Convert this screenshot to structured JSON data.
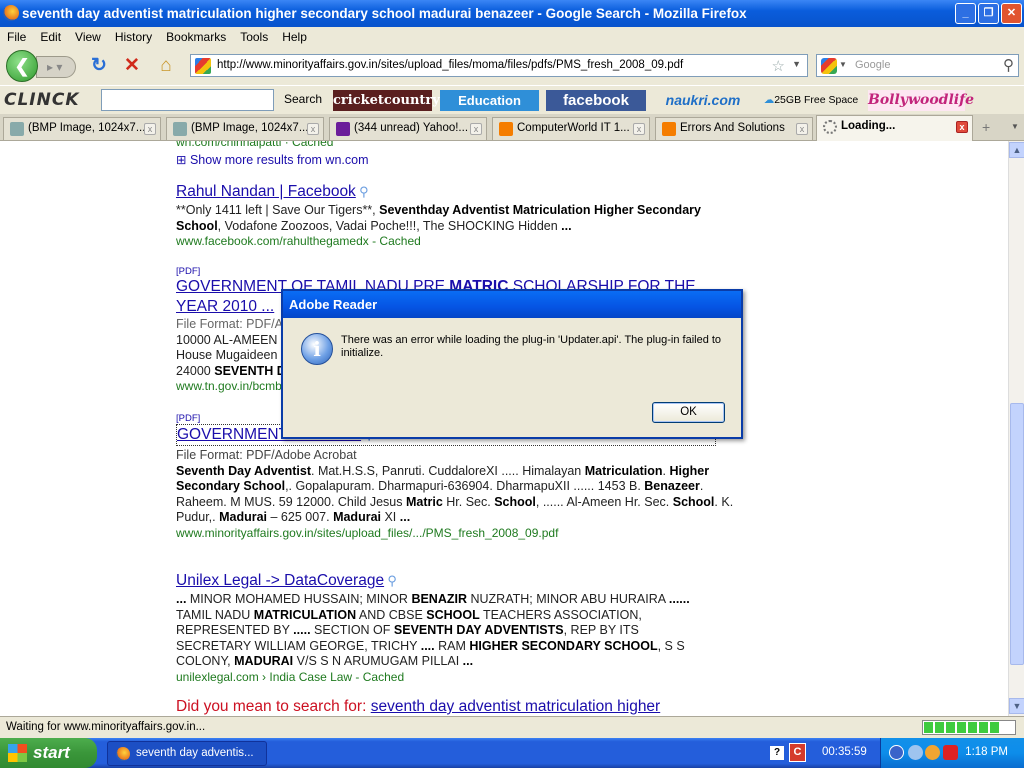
{
  "window": {
    "title": "seventh day adventist matriculation higher secondary school madurai benazeer - Google Search - Mozilla Firefox"
  },
  "menu": [
    "File",
    "Edit",
    "View",
    "History",
    "Bookmarks",
    "Tools",
    "Help"
  ],
  "nav": {
    "url": "http://www.minorityaffairs.gov.in/sites/upload_files/moma/files/pdfs/PMS_fresh_2008_09.pdf",
    "search_placeholder": "Google"
  },
  "toolbar": {
    "logo": "CLINCK",
    "search_button": "Search",
    "buttons": [
      "cricketcountry",
      "Education",
      "facebook",
      "naukri.com",
      "25GB Free Space",
      "Bollywoodlife"
    ]
  },
  "tabs": [
    {
      "label": "(BMP Image, 1024x7..."
    },
    {
      "label": "(BMP Image, 1024x7..."
    },
    {
      "label": "(344 unread) Yahoo!..."
    },
    {
      "label": "ComputerWorld IT 1..."
    },
    {
      "label": "Errors And Solutions"
    },
    {
      "label": "Loading..."
    }
  ],
  "results": {
    "top_cut": "wn.com/chinnalpatti · Cached",
    "more": "Show more results from wn.com",
    "r1": {
      "title": "Rahul Nandan | Facebook",
      "snippet_html": "**Only 1411 left | Save Our Tigers**, <b>Seventhday Adventist Matriculation Higher Secondary School</b>, Vodafone Zoozoos, Vadai Poche!!!, The SHOCKING Hidden <b>...</b>",
      "url": "www.facebook.com/rahulthegamedx - Cached"
    },
    "r2": {
      "tag": "[PDF]",
      "title_html": "GOVERNMENT OF TAMIL NADU PRE <b>MATRIC</b> SCHOLARSHIP FOR THE YEAR 2010 ...",
      "fileformat": "File Format: PDF/Adobe Acrobat",
      "snippet_html": "10000 AL-AMEEN ... <br>House Mugaideen ... <br>24000 <b>SEVENTH DAY</b> ...",
      "url": "www.tn.gov.in/bcmbcmw/..."
    },
    "r3": {
      "tag": "[PDF]",
      "title": "GOVERNMENT ... 2008 ...",
      "fileformat": "File Format: PDF/Adobe Acrobat",
      "snippet_html": "<b>Seventh Day Adventist</b>. Mat.H.S.S, Panruti. CuddaloreXI ..... Himalayan <b>Matriculation</b>. <b>Higher Secondary School</b>,. Gopalapuram. Dharmapuri-636904. DharmapuXII ...... 1453 B. <b>Benazeer</b>. Raheem. M MUS. 59 12000. Child Jesus <b>Matric</b> Hr. Sec. <b>School</b>, ...... Al-Ameen Hr. Sec. <b>School</b>. K. Pudur,. <b>Madurai</b> – 625 007. <b>Madurai</b> XI <b>...</b>",
      "url": "www.minorityaffairs.gov.in/sites/upload_files/.../PMS_fresh_2008_09.pdf"
    },
    "r4": {
      "title": "Unilex Legal -> DataCoverage",
      "snippet_html": "<b>...</b> MINOR MOHAMED HUSSAIN; MINOR <b>BENAZIR</b> NUZRATH; MINOR ABU HURAIRA <b>......</b> TAMIL NADU <b>MATRICULATION</b> AND CBSE <b>SCHOOL</b> TEACHERS ASSOCIATION, REPRESENTED BY <b>.....</b> SECTION OF <b>SEVENTH DAY ADVENTISTS</b>, REP BY ITS SECRETARY WILLIAM GEORGE, TRICHY <b>....</b> RAM <b>HIGHER SECONDARY SCHOOL</b>, S S COLONY, <b>MADURAI</b> V/S S N ARUMUGAM PILLAI <b>...</b>",
      "url": "unilexlegal.com › India Case Law - Cached"
    },
    "didyou_prefix": "Did you mean to search for:",
    "didyou_link": "seventh day adventist matriculation higher"
  },
  "status": {
    "text": "Waiting for www.minorityaffairs.gov.in...",
    "progress": 0.85
  },
  "dialog": {
    "title": "Adobe Reader",
    "message": "There was an error while loading the plug-in 'Updater.api'. The plug-in failed to initialize.",
    "ok": "OK"
  },
  "taskbar": {
    "start": "start",
    "item": "seventh day adventis...",
    "timer": "00:35:59",
    "clock": "1:18 PM"
  }
}
